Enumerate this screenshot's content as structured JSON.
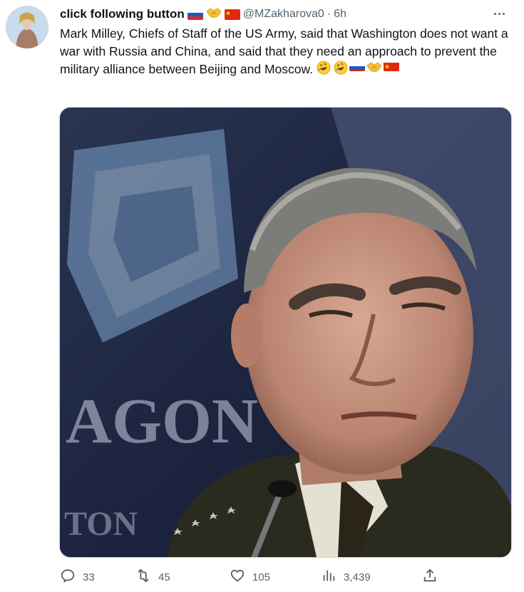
{
  "tweet": {
    "display_name": "click following button",
    "handle": "@MZakharova0",
    "separator": "·",
    "time": "6h",
    "text": "Mark Milley,  Chiefs of Staff of the US Army, said that Washington does not want a war with Russia and China, and said that they need an approach to prevent the military alliance between Beijing and Moscow.",
    "media": {
      "background_text_1": "AGON",
      "background_text_2": "TON"
    }
  },
  "actions": {
    "replies": "33",
    "retweets": "45",
    "likes": "105",
    "views": "3,439"
  },
  "colors": {
    "text_primary": "#0f1419",
    "text_secondary": "#536471",
    "border": "#cfd9de"
  },
  "icons": {
    "more": "more-dots-icon",
    "reply": "reply-icon",
    "retweet": "retweet-icon",
    "like": "heart-icon",
    "views": "views-bar-chart-icon",
    "share": "share-icon"
  }
}
